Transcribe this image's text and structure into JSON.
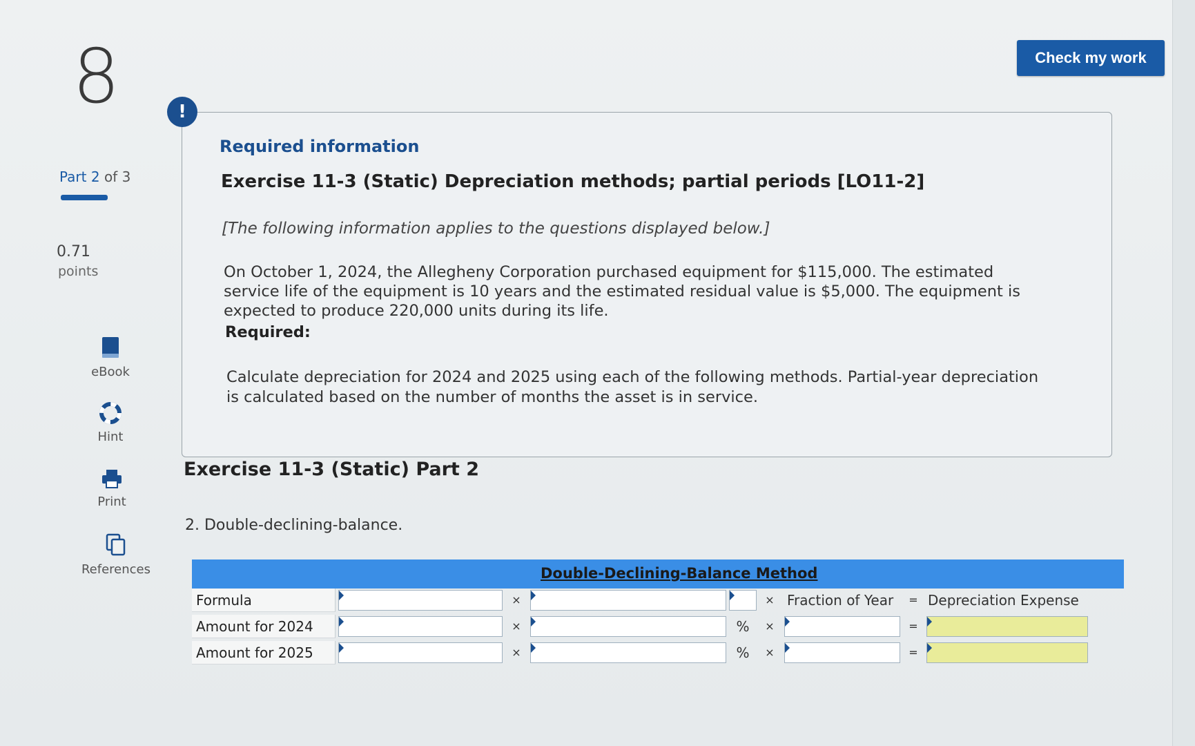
{
  "sidebar": {
    "question_number": "8",
    "part_label": "Part",
    "part_current": "2",
    "part_of": "of 3",
    "points_value": "0.71",
    "points_label": "points",
    "tools": [
      {
        "label": "eBook",
        "icon": "book-icon"
      },
      {
        "label": "Hint",
        "icon": "lifebuoy-icon"
      },
      {
        "label": "Print",
        "icon": "printer-icon"
      },
      {
        "label": "References",
        "icon": "copy-icon"
      }
    ]
  },
  "header": {
    "check_button": "Check my work"
  },
  "info": {
    "alert_symbol": "!",
    "required_information": "Required information",
    "exercise_title": "Exercise 11-3 (Static) Depreciation methods; partial periods [LO11-2]",
    "note": "[The following information applies to the questions displayed below.]",
    "paragraph": "On October 1, 2024, the Allegheny Corporation purchased equipment for $115,000. The estimated service life of the equipment is 10 years and the estimated residual value is $5,000. The equipment is expected to produce 220,000 units during its life.",
    "required_label": "Required:",
    "instructions": "Calculate depreciation for 2024 and 2025 using each of the following methods. Partial-year depreciation is calculated based on the number of months the asset is in service."
  },
  "main": {
    "part_title": "Exercise 11-3 (Static) Part 2",
    "question": "2. Double-declining-balance.",
    "table": {
      "header": "Double-Declining-Balance Method",
      "rows": [
        {
          "label": "Formula",
          "mult1": "×",
          "mult2": "×",
          "fraction": "Fraction of Year",
          "equals": "=",
          "result": "Depreciation Expense"
        },
        {
          "label": "Amount for 2024",
          "mult1": "×",
          "pct": "%",
          "mult2": "×",
          "equals": "="
        },
        {
          "label": "Amount for 2025",
          "mult1": "×",
          "pct": "%",
          "mult2": "×",
          "equals": "="
        }
      ]
    }
  },
  "colors": {
    "accent": "#1a5ba6",
    "table_header": "#3a8ee6",
    "answer_cell": "#e9ec9a"
  }
}
